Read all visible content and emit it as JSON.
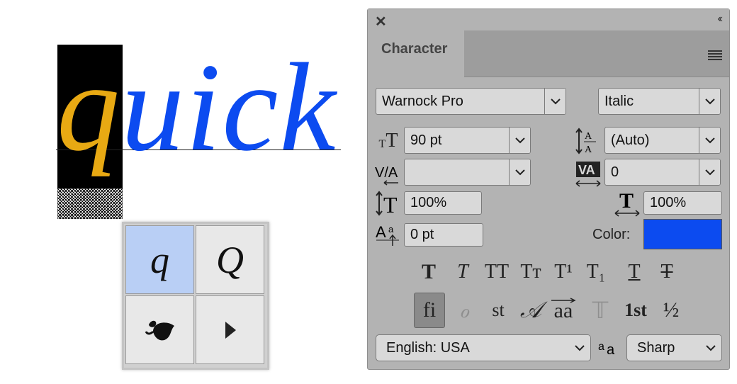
{
  "canvas": {
    "word_selected": "q",
    "word_rest": "uick",
    "selected_color": "#e8a913",
    "text_color": "#0c4bf0"
  },
  "alternates": {
    "cells": [
      {
        "glyph": "q",
        "style": "italic",
        "active": true
      },
      {
        "glyph": "Q",
        "style": "italic",
        "active": false
      },
      {
        "glyph": "❧",
        "style": "ornament",
        "active": false
      },
      {
        "glyph": "▶",
        "style": "more",
        "active": false
      }
    ]
  },
  "panel": {
    "title": "Character",
    "font_family": "Warnock Pro",
    "font_style": "Italic",
    "font_size": "90 pt",
    "leading": "(Auto)",
    "kerning": "",
    "tracking": "0",
    "vertical_scale": "100%",
    "horizontal_scale": "100%",
    "baseline_shift": "0 pt",
    "color_label": "Color:",
    "color_value": "#0c4bf0",
    "language": "English: USA",
    "antialias": "Sharp",
    "style_buttons": [
      {
        "name": "faux-bold",
        "glyph": "T"
      },
      {
        "name": "faux-italic",
        "glyph": "T"
      },
      {
        "name": "all-caps",
        "glyph": "TT"
      },
      {
        "name": "small-caps",
        "glyph": "Tт"
      },
      {
        "name": "superscript",
        "glyph": "T¹"
      },
      {
        "name": "subscript",
        "glyph": "T₁"
      },
      {
        "name": "underline",
        "glyph": "T"
      },
      {
        "name": "strikethrough",
        "glyph": "T"
      }
    ],
    "opentype_buttons": [
      {
        "name": "standard-ligatures",
        "glyph": "fi",
        "active": true
      },
      {
        "name": "contextual-alternates",
        "glyph": "ℴ",
        "active": false,
        "dim": true
      },
      {
        "name": "discretionary-ligatures",
        "glyph": "st",
        "active": false
      },
      {
        "name": "swash",
        "glyph": "𝒜",
        "active": false
      },
      {
        "name": "stylistic-alternates",
        "glyph": "aa",
        "active": false
      },
      {
        "name": "titling-alternates",
        "glyph": "𝕋",
        "active": false,
        "dim": true
      },
      {
        "name": "ordinals",
        "glyph": "1st",
        "active": false
      },
      {
        "name": "fractions",
        "glyph": "½",
        "active": false
      }
    ]
  }
}
